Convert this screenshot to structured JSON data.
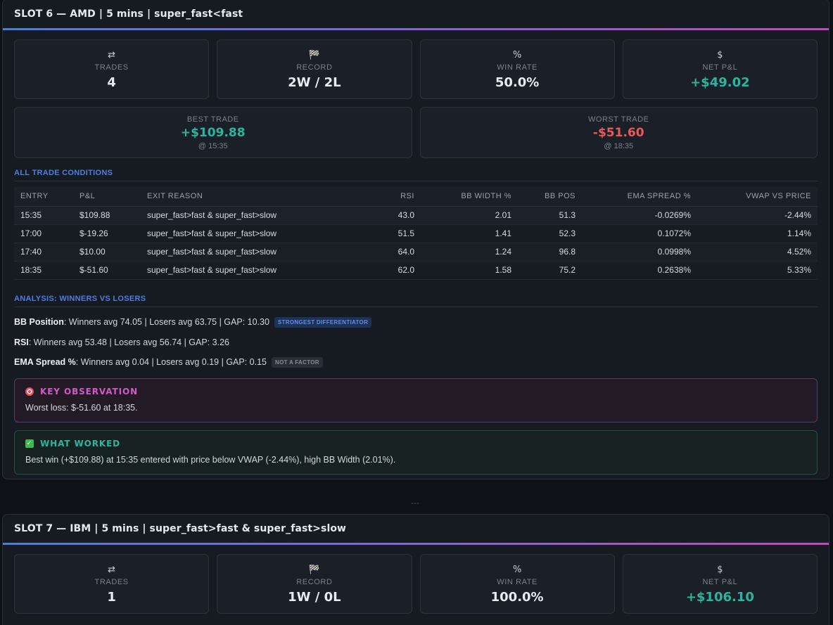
{
  "slot6": {
    "title": "SLOT 6 — AMD | 5 mins | super_fast<fast",
    "stats": [
      {
        "icon": "⇄",
        "label": "TRADES",
        "value": "4"
      },
      {
        "icon": "🏁",
        "label": "RECORD",
        "value": "2W / 2L"
      },
      {
        "icon": "%",
        "label": "WIN RATE",
        "value": "50.0%"
      },
      {
        "icon": "$",
        "label": "NET P&L",
        "value": "+$49.02"
      }
    ],
    "best": {
      "label": "BEST TRADE",
      "value": "+$109.88",
      "time": "@ 15:35"
    },
    "worst": {
      "label": "WORST TRADE",
      "value": "-$51.60",
      "time": "@ 18:35"
    },
    "conditions_title": "ALL TRADE CONDITIONS",
    "table": {
      "headers": [
        "ENTRY",
        "P&L",
        "EXIT REASON",
        "RSI",
        "BB WIDTH %",
        "BB POS",
        "EMA SPREAD %",
        "VWAP VS PRICE"
      ],
      "rows": [
        [
          "15:35",
          "$109.88",
          "super_fast>fast & super_fast>slow",
          "43.0",
          "2.01",
          "51.3",
          "-0.0269%",
          "-2.44%"
        ],
        [
          "17:00",
          "$-19.26",
          "super_fast>fast & super_fast>slow",
          "51.5",
          "1.41",
          "52.3",
          "0.1072%",
          "1.14%"
        ],
        [
          "17:40",
          "$10.00",
          "super_fast>fast & super_fast>slow",
          "64.0",
          "1.24",
          "96.8",
          "0.0998%",
          "4.52%"
        ],
        [
          "18:35",
          "$-51.60",
          "super_fast>fast & super_fast>slow",
          "62.0",
          "1.58",
          "75.2",
          "0.2638%",
          "5.33%"
        ]
      ]
    },
    "analysis_title": "ANALYSIS: WINNERS VS LOSERS",
    "analysis": [
      {
        "label": "BB Position",
        "text": ": Winners avg 74.05 | Losers avg 63.75 | GAP: 10.30",
        "badge": "STRONGEST DIFFERENTIATOR"
      },
      {
        "label": "RSI",
        "text": ": Winners avg 53.48 | Losers avg 56.74 | GAP: 3.26",
        "badge": ""
      },
      {
        "label": "EMA Spread %",
        "text": ": Winners avg 0.04 | Losers avg 0.19 | GAP: 0.15",
        "badge": "NOT A FACTOR"
      }
    ],
    "observation": {
      "title": "KEY OBSERVATION",
      "text": "Worst loss: $-51.60 at 18:35."
    },
    "worked": {
      "title": "WHAT WORKED",
      "text": "Best win (+$109.88) at 15:35 entered with price below VWAP (-2.44%), high BB Width (2.01%)."
    }
  },
  "divider": "---",
  "slot7": {
    "title": "SLOT 7 — IBM | 5 mins | super_fast>fast & super_fast>slow",
    "stats": [
      {
        "icon": "⇄",
        "label": "TRADES",
        "value": "1"
      },
      {
        "icon": "🏁",
        "label": "RECORD",
        "value": "1W / 0L"
      },
      {
        "icon": "%",
        "label": "WIN RATE",
        "value": "100.0%"
      },
      {
        "icon": "$",
        "label": "NET P&L",
        "value": "+$106.10"
      }
    ]
  },
  "colors": {
    "positive": "#2bb5a0",
    "negative": "#ec5a55",
    "accent_blue": "#4b7fe0",
    "accent_purple": "#d25ac8",
    "background": "#0e1116",
    "panel": "#161a21"
  }
}
